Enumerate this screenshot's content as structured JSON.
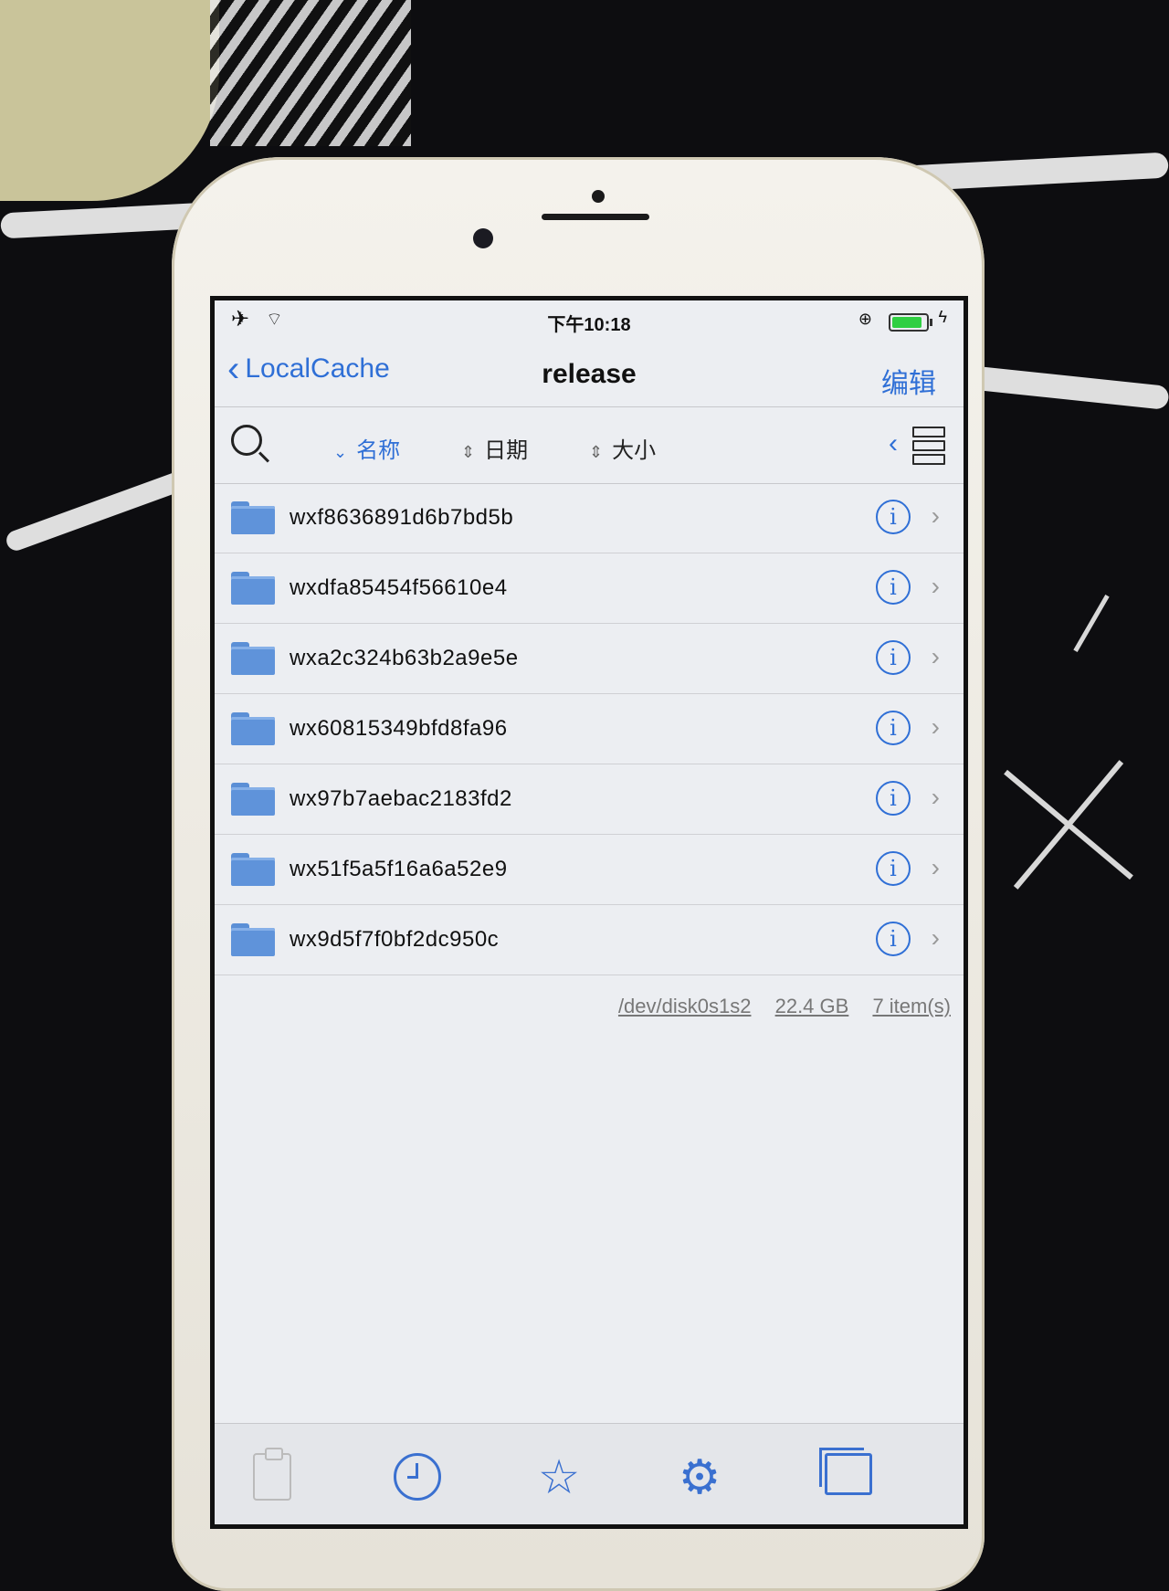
{
  "status_bar": {
    "time": "下午10:18",
    "airplane_glyph": "✈",
    "wifi_glyph": "⌔",
    "battery_level": 0.95
  },
  "nav": {
    "back_label": "LocalCache",
    "title": "release",
    "edit_label": "编辑"
  },
  "sort_bar": {
    "name_label": "名称",
    "date_label": "日期",
    "size_label": "大小"
  },
  "files": [
    {
      "name": "wxf8636891d6b7bd5b"
    },
    {
      "name": "wxdfa85454f56610e4"
    },
    {
      "name": "wxa2c324b63b2a9e5e"
    },
    {
      "name": "wx60815349bfd8fa96"
    },
    {
      "name": "wx97b7aebac2183fd2"
    },
    {
      "name": "wx51f5a5f16a6a52e9"
    },
    {
      "name": "wx9d5f7f0bf2dc950c"
    }
  ],
  "footer": {
    "device": "/dev/disk0s1s2",
    "capacity": "22.4 GB",
    "count": "7 item(s)"
  },
  "icons": {
    "info": "i",
    "chevron_right": "›",
    "chevron_left": "‹",
    "star": "☆",
    "gear": "⚙"
  },
  "colors": {
    "accent": "#2f6fd6",
    "folder": "#5f93da",
    "battery": "#2fcf42"
  }
}
